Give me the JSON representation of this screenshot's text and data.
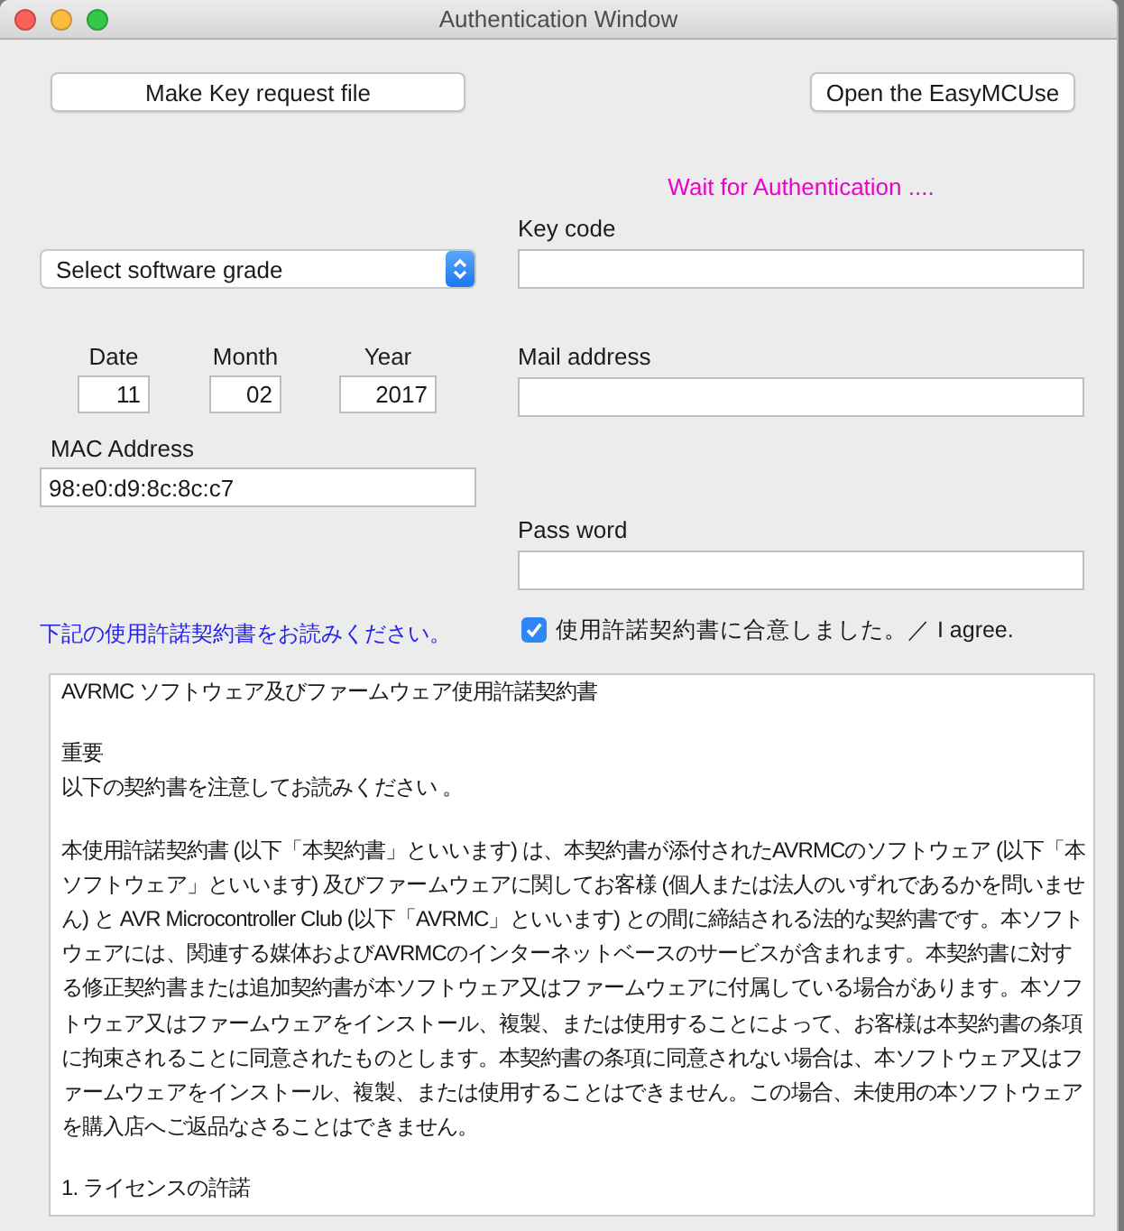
{
  "window": {
    "title": "Authentication Window"
  },
  "buttons": [
    {
      "label": "Make Key request file"
    },
    {
      "label": "Open the EasyMCUse"
    }
  ],
  "status": "Wait for Authentication ....",
  "grade_select": {
    "value": "Select software grade"
  },
  "date_fields": [
    {
      "label": "Date",
      "value": "11"
    },
    {
      "label": "Month",
      "value": "02"
    },
    {
      "label": "Year",
      "value": "2017"
    }
  ],
  "mac_address": {
    "label": "MAC Address",
    "value": "98:e0:d9:8c:8c:c7"
  },
  "right_fields": [
    {
      "label": "Key code"
    },
    {
      "label": "Mail address"
    },
    {
      "label": "Pass word"
    }
  ],
  "read_notice": "下記の使用許諾契約書をお読みください。",
  "agree": {
    "label": "使用許諾契約書に合意しました。／ I agree.",
    "checked": true
  },
  "license": {
    "paragraphs": [
      {
        "lines": [
          "AVRMC ソフトウェア及びファームウェア使用許諾契約書"
        ]
      },
      {
        "lines": [
          "重要",
          "以下の契約書を注意してお読みください 。"
        ]
      },
      {
        "lines": [
          "本使用許諾契約書 (以下「本契約書」といいます) は、本契約書が添付されたAVRMCのソフトウェア (以下「本ソフトウェア」といいます) 及びファームウェアに関してお客様 (個人または法人のいずれであるかを問いません) と AVR Microcontroller Club (以下「AVRMC」といいます) との間に締結される法的な契約書です。本ソフトウェアには、関連する媒体およびAVRMCのインターネットベースのサービスが含まれます。本契約書に対する修正契約書または追加契約書が本ソフトウェア又はファームウェアに付属している場合があります。本ソフトウェア又はファームウェアをインストール、複製、または使用することによって、お客様は本契約書の条項に拘束されることに同意されたものとします。本契約書の条項に同意されない場合は、本ソフトウェア又はファームウェアをインストール、複製、または使用することはできません。この場合、未使用の本ソフトウェアを購入店へご返品なさることはできません。"
        ]
      },
      {
        "lines": [
          "1. ライセンスの許諾"
        ]
      }
    ]
  }
}
